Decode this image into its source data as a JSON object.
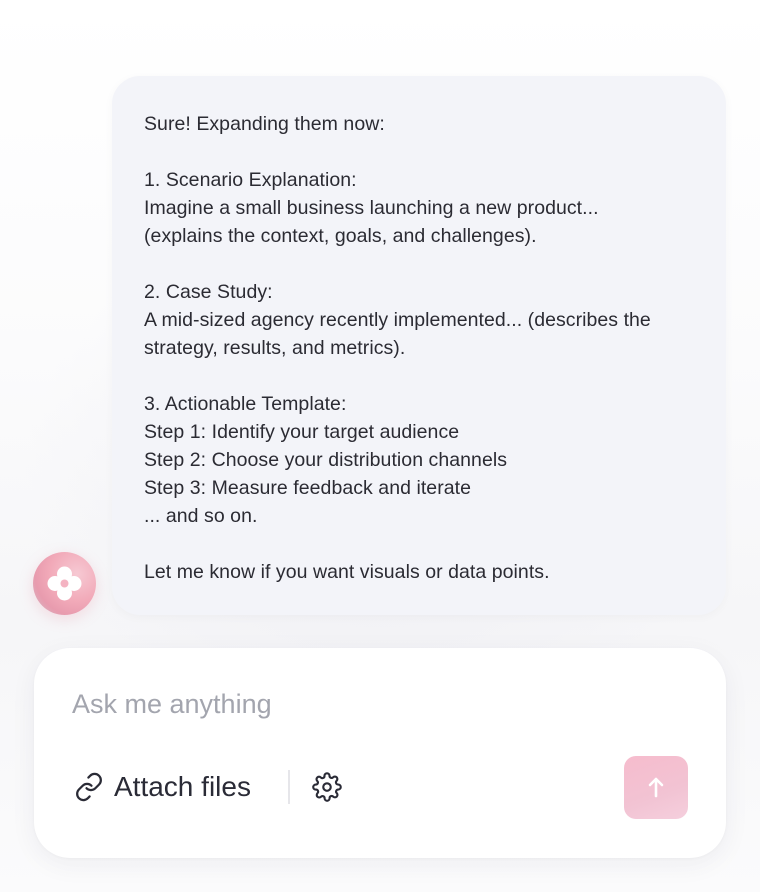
{
  "message": {
    "lines": [
      "Sure! Expanding them now:",
      "",
      "1. Scenario Explanation:",
      "Imagine a small business launching a new product...",
      "(explains the context, goals, and challenges).",
      "",
      "2. Case Study:",
      "A mid-sized agency recently implemented... (describes the",
      "strategy, results, and metrics).",
      "",
      "3. Actionable Template:",
      "Step 1: Identify your target audience",
      "Step 2: Choose your distribution channels",
      "Step 3: Measure feedback and iterate",
      "... and so on.",
      "",
      "Let me know if you want visuals or data points."
    ]
  },
  "assistant": {
    "avatar_icon": "flower-logo-icon",
    "avatar_color": "#f2aab9"
  },
  "composer": {
    "placeholder": "Ask me anything",
    "attach_label": "Attach files",
    "attach_icon": "link-icon",
    "settings_icon": "gear-icon",
    "send_icon": "arrow-up-icon",
    "send_color": "#f6bccd"
  }
}
